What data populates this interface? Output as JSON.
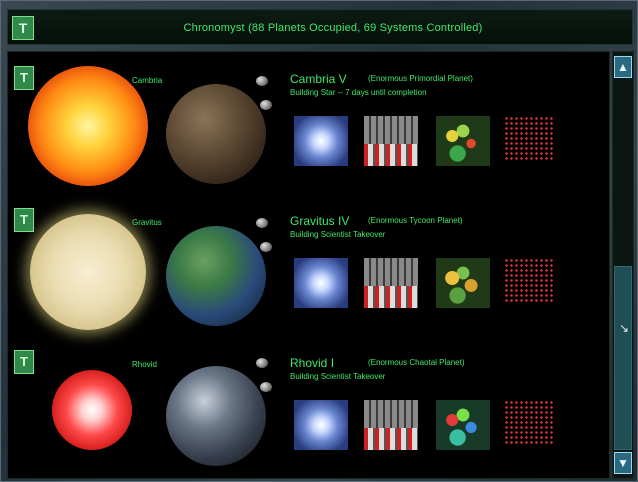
{
  "window": {
    "title": "Chronomyst   (88 Planets Occupied, 69 Systems Controlled)",
    "title_icon": "T"
  },
  "colors": {
    "text_green": "#3fe86a",
    "icon_green": "#2f8a4a",
    "scroll_blue": "#2a6a80"
  },
  "rows": [
    {
      "icon": "T",
      "star_name": "Cambria",
      "planet_name": "Cambria V",
      "planet_type": "(Enormous Primordial Planet)",
      "planet_status": "Building Star -- 7 days until completion"
    },
    {
      "icon": "T",
      "star_name": "Gravitus",
      "planet_name": "Gravitus IV",
      "planet_type": "(Enormous Tycoon Planet)",
      "planet_status": "Building Scientist Takeover"
    },
    {
      "icon": "T",
      "star_name": "Rhovid",
      "planet_name": "Rhovid I",
      "planet_type": "(Enormous Chaotal Planet)",
      "planet_status": "Building Scientist Takeover"
    }
  ],
  "scrollbar": {
    "up_glyph": "▲",
    "down_glyph": "▼"
  }
}
